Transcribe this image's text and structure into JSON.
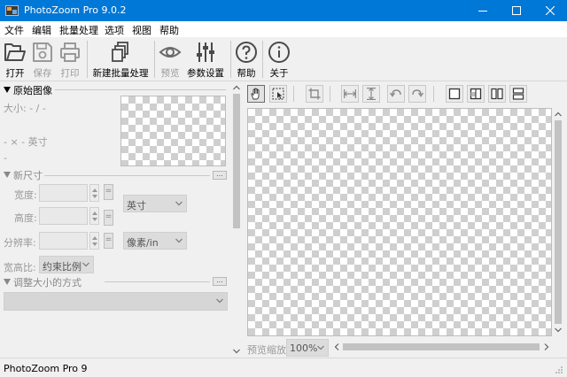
{
  "window": {
    "title": "PhotoZoom Pro 9.0.2"
  },
  "menu": [
    "文件",
    "编辑",
    "批量处理",
    "选项",
    "视图",
    "帮助"
  ],
  "toolbar": {
    "open": "打开",
    "save": "保存",
    "print": "打印",
    "new_batch": "新建批量处理",
    "preview": "预览",
    "params": "参数设置",
    "help": "帮助",
    "about": "关于"
  },
  "original": {
    "header": "原始图像",
    "size": "大小: - / -",
    "dims": "- × - 英寸",
    "extra": "-"
  },
  "new_size": {
    "header": "新尺寸",
    "width_label": "宽度:",
    "height_label": "高度:",
    "resolution_label": "分辨率:",
    "eq": "=",
    "unit": "英寸",
    "res_unit": "像素/in",
    "aspect_label": "宽高比:",
    "aspect_value": "约束比例"
  },
  "resize_method": {
    "header": "调整大小的方式",
    "dots": "..."
  },
  "preview": {
    "zoom_label": "预览缩放:",
    "zoom_value": "100%"
  },
  "status": {
    "text": "PhotoZoom Pro 9"
  },
  "colors": {
    "titlebar": "#0078d7",
    "accent_blue": "#1f5fa8"
  }
}
